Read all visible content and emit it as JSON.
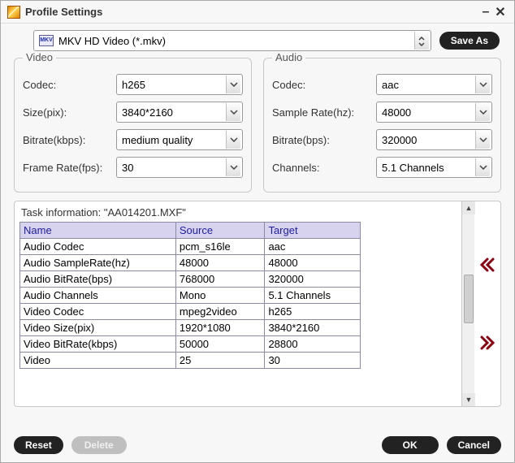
{
  "titlebar": {
    "title": "Profile Settings"
  },
  "profile": {
    "selected_label": "MKV HD Video (*.mkv)",
    "icon_text": "MKV",
    "save_as_label": "Save As"
  },
  "video": {
    "legend": "Video",
    "codec_label": "Codec:",
    "codec_value": "h265",
    "size_label": "Size(pix):",
    "size_value": "3840*2160",
    "bitrate_label": "Bitrate(kbps):",
    "bitrate_value": "medium quality",
    "fps_label": "Frame Rate(fps):",
    "fps_value": "30"
  },
  "audio": {
    "legend": "Audio",
    "codec_label": "Codec:",
    "codec_value": "aac",
    "rate_label": "Sample Rate(hz):",
    "rate_value": "48000",
    "bitrate_label": "Bitrate(bps):",
    "bitrate_value": "320000",
    "channels_label": "Channels:",
    "channels_value": "5.1 Channels"
  },
  "task": {
    "title": "Task information: \"AA014201.MXF\"",
    "columns": [
      "Name",
      "Source",
      "Target"
    ],
    "rows": [
      [
        "Audio Codec",
        "pcm_s16le",
        "aac"
      ],
      [
        "Audio SampleRate(hz)",
        "48000",
        "48000"
      ],
      [
        "Audio BitRate(bps)",
        "768000",
        "320000"
      ],
      [
        "Audio Channels",
        "Mono",
        "5.1 Channels"
      ],
      [
        "Video Codec",
        "mpeg2video",
        "h265"
      ],
      [
        "Video Size(pix)",
        "1920*1080",
        "3840*2160"
      ],
      [
        "Video BitRate(kbps)",
        "50000",
        "28800"
      ],
      [
        "Video",
        "25",
        "30"
      ]
    ]
  },
  "footer": {
    "reset_label": "Reset",
    "delete_label": "Delete",
    "ok_label": "OK",
    "cancel_label": "Cancel"
  }
}
